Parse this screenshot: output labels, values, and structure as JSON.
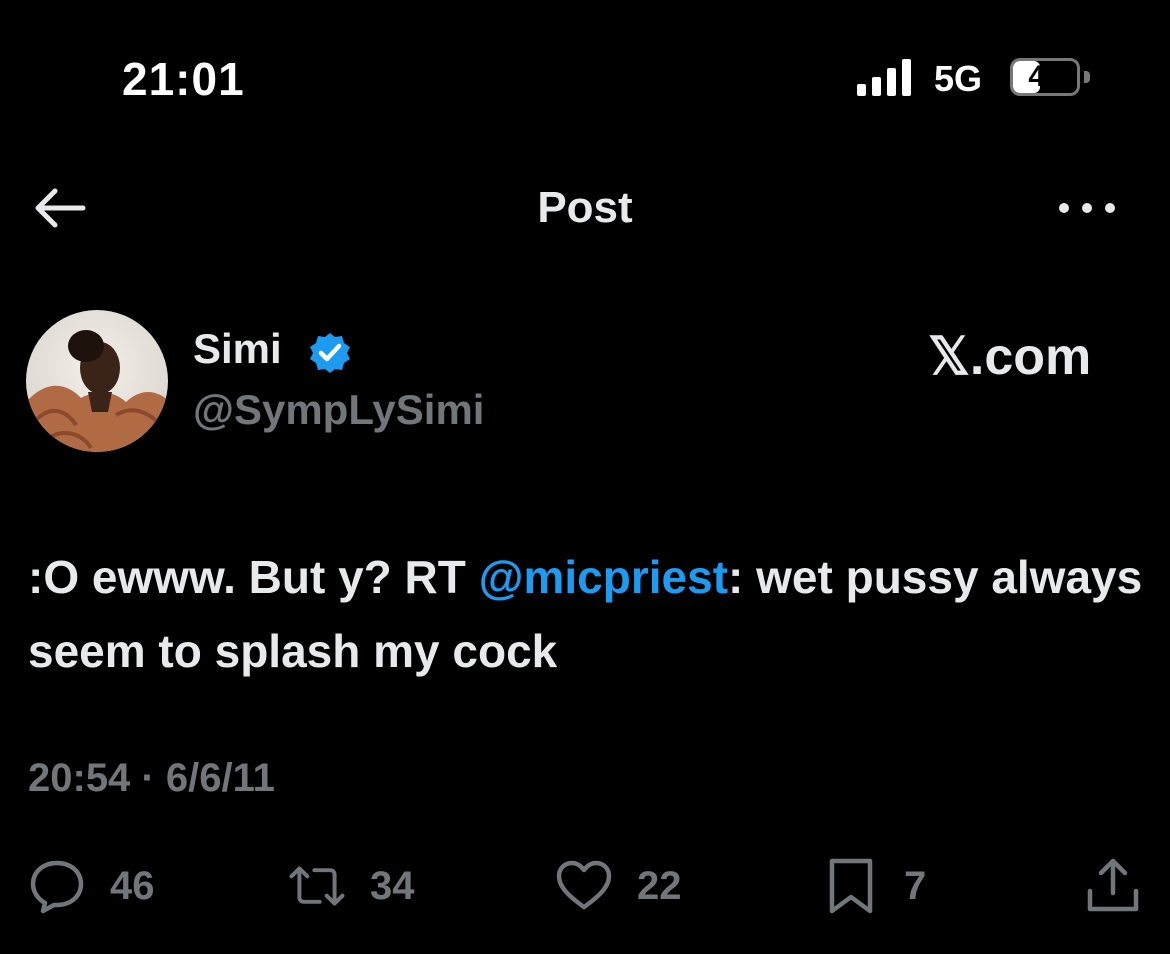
{
  "status_bar": {
    "time": "21:01",
    "network": "5G",
    "battery": "42",
    "battery_level": 0.42
  },
  "header": {
    "title": "Post",
    "back_icon": "arrow-left-icon",
    "more_icon": "more-horizontal-icon"
  },
  "author": {
    "name": "Simi",
    "handle": "@SympLySimi",
    "verified": true,
    "source": "𝕏.com"
  },
  "tweet": {
    "text_before": ":O ewww. But y? RT ",
    "mention": "@micpriest",
    "text_after": ": wet pussy always seem to splash my cock"
  },
  "timestamp": "20:54 · 6/6/11",
  "actions": {
    "replies": "46",
    "retweets": "34",
    "likes": "22",
    "bookmarks": "7"
  },
  "colors": {
    "background": "#000000",
    "text": "#e7e9ea",
    "muted": "#71767b",
    "accent": "#1d9bf0"
  }
}
